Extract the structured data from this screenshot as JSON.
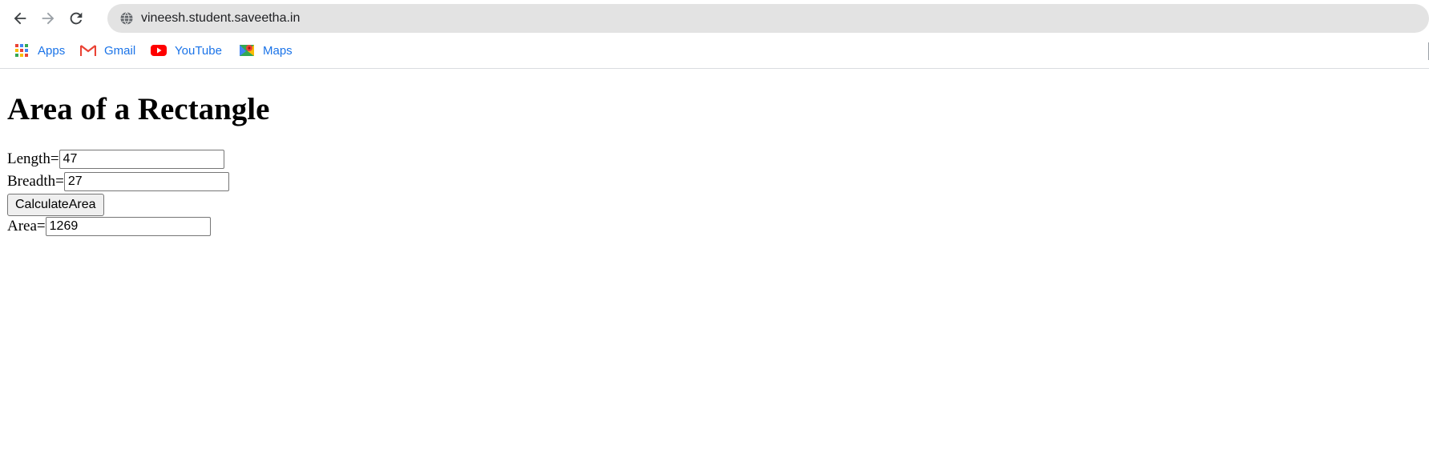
{
  "browser": {
    "url": "vineesh.student.saveetha.in",
    "bookmarks": [
      {
        "label": "Apps",
        "icon": "apps-grid-icon"
      },
      {
        "label": "Gmail",
        "icon": "gmail-icon"
      },
      {
        "label": "YouTube",
        "icon": "youtube-icon"
      },
      {
        "label": "Maps",
        "icon": "maps-icon"
      }
    ]
  },
  "page": {
    "title": "Area of a Rectangle",
    "length_label": "Length=",
    "length_value": "47",
    "breadth_label": "Breadth=",
    "breadth_value": "27",
    "button_label": "CalculateArea",
    "area_label": "Area=",
    "area_value": "1269"
  },
  "colors": {
    "bookmark_text": "#1a73e8",
    "omnibox_bg": "#e3e3e3"
  }
}
